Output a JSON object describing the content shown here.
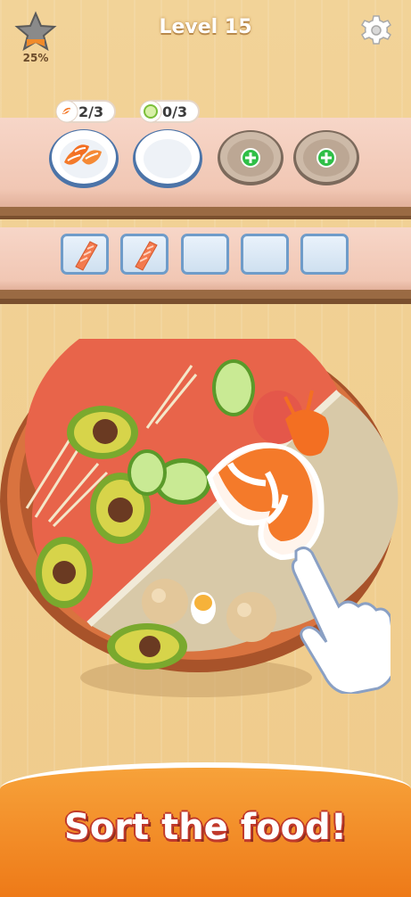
{
  "hud": {
    "level_title": "Level 15",
    "progress_text": "25%",
    "star_icon": "star-icon",
    "settings_icon": "gear-icon"
  },
  "orders": [
    {
      "icon": "shrimp-icon",
      "count_text": "2/3",
      "plate_state": "filled-shrimp"
    },
    {
      "icon": "cucumber-icon",
      "count_text": "0/3",
      "plate_state": "empty"
    },
    {
      "plate_state": "locked-add",
      "icon": "plus-icon"
    },
    {
      "plate_state": "locked-add",
      "icon": "plus-icon"
    }
  ],
  "holding_slots": [
    {
      "item": "salmon-icon"
    },
    {
      "item": "salmon-icon"
    },
    {
      "item": "empty"
    },
    {
      "item": "empty"
    },
    {
      "item": "empty"
    }
  ],
  "bowl": {
    "contents": [
      "avocado",
      "cucumber",
      "enoki-mushroom",
      "shrimp",
      "fish-ball",
      "quail-egg",
      "tomato"
    ],
    "hint_hand_icon": "pointer-hand-icon"
  },
  "banner": {
    "text": "Sort the food!"
  },
  "colors": {
    "accent_orange": "#ee7a18",
    "banner_outline": "#c0392b",
    "slot_border": "#6f9cc9",
    "add_button_green": "#2fbf47"
  }
}
